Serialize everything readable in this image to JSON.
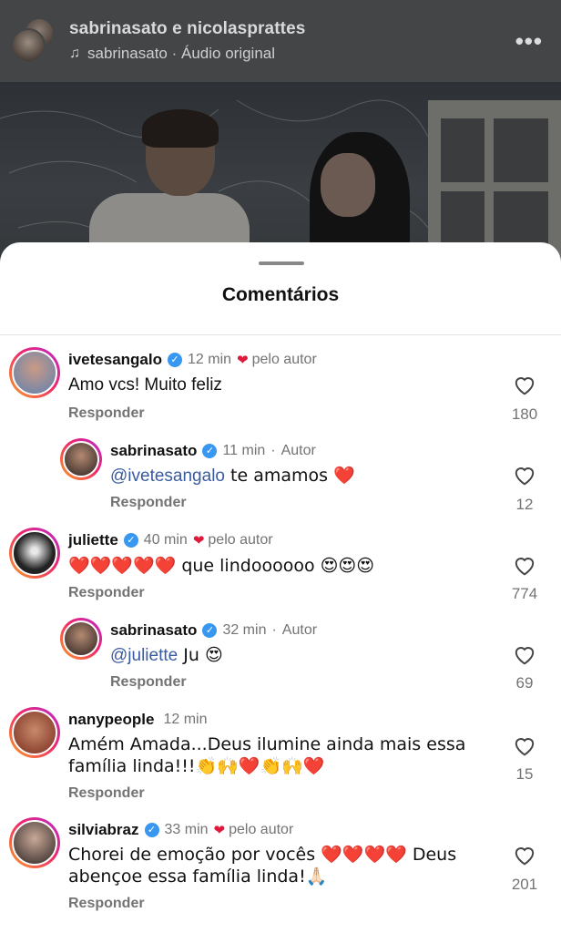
{
  "header": {
    "title": "sabrinasato e nicolasprattes",
    "audio": "sabrinasato · Áudio original",
    "more_icon": "more-horizontal-icon"
  },
  "sheet": {
    "title": "Comentários"
  },
  "comments": [
    {
      "user": "ivetesangalo",
      "time": "12 min",
      "by_author": "pelo autor",
      "text": "Amo vcs! Muito feliz",
      "reply": "Responder",
      "likes": "180"
    },
    {
      "user": "sabrinasato",
      "time": "11 min",
      "author_tag": "Autor",
      "mention": "@ivetesangalo",
      "text": " te amamos ❤️",
      "reply": "Responder",
      "likes": "12"
    },
    {
      "user": "juliette",
      "time": "40 min",
      "by_author": "pelo autor",
      "text": "❤️❤️❤️❤️❤️ que lindoooooo 😍😍😍",
      "reply": "Responder",
      "likes": "774"
    },
    {
      "user": "sabrinasato",
      "time": "32 min",
      "author_tag": "Autor",
      "mention": "@juliette",
      "text": " Ju 😍",
      "reply": "Responder",
      "likes": "69"
    },
    {
      "user": "nanypeople",
      "time": "12 min",
      "text": "Amém Amada...Deus ilumine ainda mais essa família linda!!!👏🙌❤️👏🙌❤️",
      "reply": "Responder",
      "likes": "15"
    },
    {
      "user": "silviabraz",
      "time": "33 min",
      "by_author": "pelo autor",
      "text": "Chorei de emoção por vocês ❤️❤️❤️❤️ Deus abençoe essa família linda!🙏🏻",
      "reply": "Responder",
      "likes": "201"
    }
  ],
  "colors": {
    "accent_heart": "#e0193c",
    "mention": "#3a5ba0",
    "verified": "#3897f0",
    "muted": "#737373"
  }
}
